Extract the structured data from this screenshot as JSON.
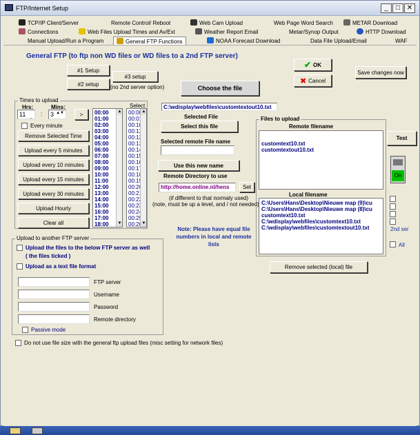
{
  "window": {
    "title": "FTP/Internet Setup"
  },
  "tabs_row1": [
    "TCP/IP Client/Server",
    "Remote Control/ Reboot",
    "Web Cam Upload",
    "Web Page Word Search",
    "METAR Download"
  ],
  "tabs_row2": [
    "Connections",
    "Web Files Upload Times and Av/Ext",
    "Weather Report Email",
    "Metar/Synop Output",
    "HTTP Download"
  ],
  "tabs_row3": [
    "Manual Upload/Run a Program",
    "General FTP Functions",
    "NOAA Forecast Download",
    "Data File Upload/Email",
    "WAF"
  ],
  "main": {
    "heading": "General FTP (to ftp non WD files or WD files to a 2nd FTP server)",
    "setup1": "#1 Setup",
    "setup2": "#2 setup",
    "setup3": "#3 setup",
    "no_2nd": "(no 2nd server option)",
    "choose_file": "Choose the file",
    "ok": "OK",
    "cancel": "Cancel",
    "save_changes": "Save changes now",
    "file_path": "C:\\wdisplay\\webfiles\\customtextout10.txt",
    "selected_file": "Selected File",
    "select_this_file": "Select this file",
    "selected_remote": "Selected remote File name",
    "use_new_name": "Use this new name",
    "remote_dir": "Remote Directory to use",
    "remote_dir_value": "http://home.online.nl/hens",
    "set": "Set",
    "if_different": "(if different to that normaly used)",
    "note_level": "(note, must be up a level, and / not needed)",
    "note_equal": "Note: Please have equal file numbers in local and remote lists",
    "files_to_upload": "Files to upload",
    "remote_filename": "Remote filename",
    "remote_files": [
      "customtext10.txt",
      "customtextout10.txt"
    ],
    "local_filename": "Local filename",
    "local_files": [
      "C:\\Users\\Hans\\Desktop\\Nieuwe map (9)\\cu",
      "C:\\Users\\Hans\\Desktop\\Nieuwe map (8)\\cu",
      "customtext10.txt",
      "C:\\wdisplay\\webfiles\\customtext10.txt",
      "C:\\wdisplay\\webfiles\\customtextout10.txt"
    ],
    "remove_local": "Remove selected (local) file",
    "test": "Test",
    "on": "On",
    "second_server": "2nd ser",
    "all": "All"
  },
  "times": {
    "legend": "Times to upload",
    "hrs": "Hrs:",
    "mins": "Mins:",
    "hrs_value": "11",
    "mins_value": "3",
    "go": ">",
    "every_minute": "Every minute",
    "remove_selected": "Remove Selected Time",
    "every5": "Upload every 5 minutes",
    "every10": "Upload every 10 minutes",
    "every15": "Upload every 15 minutes",
    "every30": "Upload every 30 minutes",
    "hourly": "Upload Hourly",
    "clear_all": "Clear all",
    "select": "Select",
    "hour_list": [
      "00:00",
      "01:00",
      "02:00",
      "03:00",
      "04:00",
      "05:00",
      "06:00",
      "07:00",
      "08:00",
      "09:00",
      "10:00",
      "11:00",
      "12:00",
      "13:00",
      "14:00",
      "15:00",
      "16:00",
      "17:00",
      "18:00"
    ],
    "minute_list": [
      "00:00",
      "00:01",
      "00:10",
      "00:11",
      "00:12",
      "00:13",
      "00:14",
      "00:15",
      "00:16",
      "00:17",
      "00:18",
      "00:19",
      "00:20",
      "00:21",
      "00:22",
      "00:23",
      "00:24",
      "00:25",
      "00:26"
    ]
  },
  "upload": {
    "legend": "Upload to another FTP server",
    "upload_files": "Upload the files to the below FTP server as well",
    "files_ticked": "( the files ticked )",
    "as_text": "Upload as a text file format",
    "ftp_server": "FTP server",
    "username": "Username",
    "password": "Password",
    "remote_directory": "Remote directory",
    "passive": "Passive mode"
  },
  "bottom": {
    "no_file_size": "Do not use file size with the general ftp upload files (misc setting for network files)"
  },
  "colors": {
    "heading": "#1a2fa0",
    "navy": "#000080",
    "purple": "#800080",
    "green": "#00c000"
  }
}
